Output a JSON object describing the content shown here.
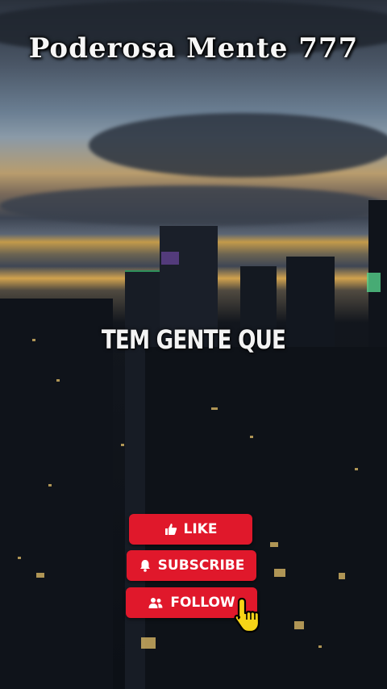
{
  "overlay": {
    "title": "Poderosa Mente 777",
    "caption": "TEM GENTE QUE"
  },
  "buttons": {
    "like": {
      "label": "LIKE",
      "icon": "thumbs-up-icon"
    },
    "subscribe": {
      "label": "SUBSCRIBE",
      "icon": "bell-icon"
    },
    "follow": {
      "label": "FOLLOW",
      "icon": "users-icon"
    }
  },
  "cursor_icon": "pointing-hand-icon",
  "colors": {
    "button_red": "#e0182b",
    "text_white": "#f6f6f6"
  }
}
